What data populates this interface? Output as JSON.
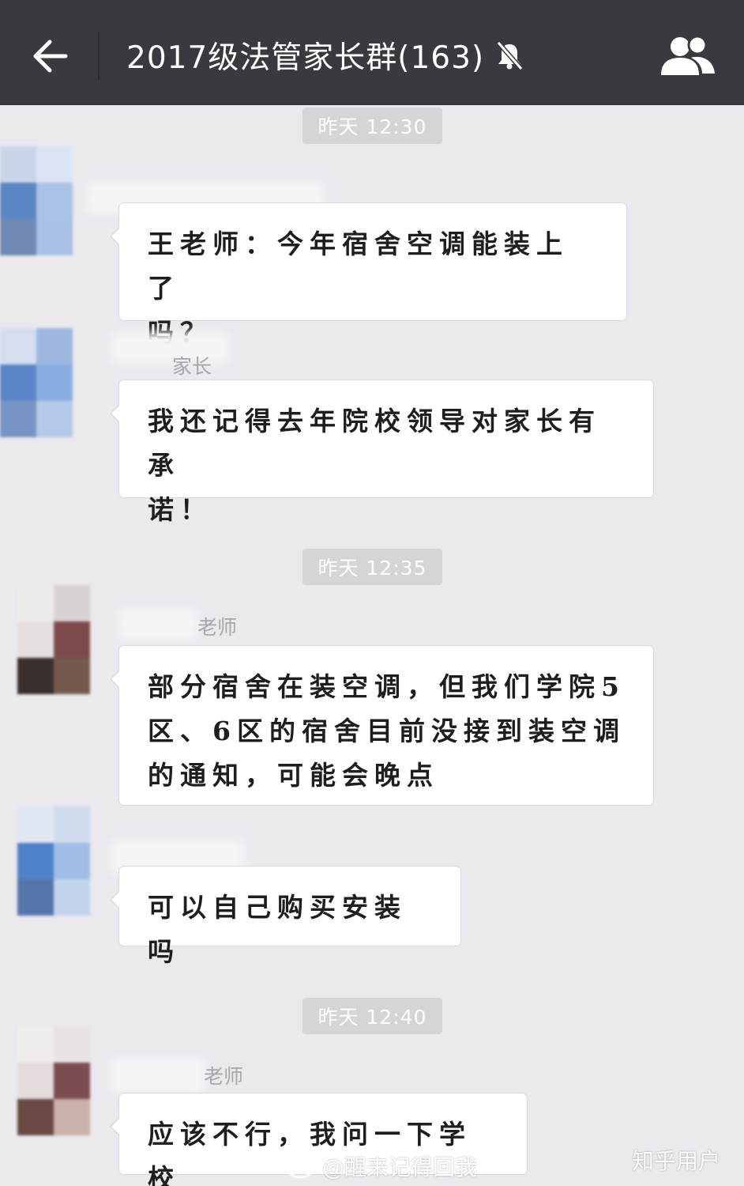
{
  "header": {
    "title": "2017级法管家长群(163)",
    "back_icon": "arrow-left-icon",
    "mute_icon": "bell-muted-icon",
    "members_icon": "group-members-icon",
    "background": "#393a3f"
  },
  "timestamps": [
    "昨天 12:30",
    "昨天 12:35",
    "昨天 12:40"
  ],
  "senders": [
    "家长",
    "老师",
    "老师"
  ],
  "messages": [
    {
      "line1": "王老师：今年宿舍空调能装上了",
      "line2": "吗？"
    },
    {
      "line1": "我还记得去年院校领导对家长有承",
      "line2": "诺！"
    },
    {
      "line1": "部分宿舍在装空调，但我们学院5",
      "line2": "区、6区的宿舍目前没接到装空调",
      "line3": "的通知，可能会晚点"
    },
    {
      "line1": "可以自己购买安装吗"
    },
    {
      "line1": "应该不行，我问一下学校"
    }
  ],
  "watermarks": {
    "weibo": "@醒来记得回我",
    "zhihu": "知乎用户"
  }
}
